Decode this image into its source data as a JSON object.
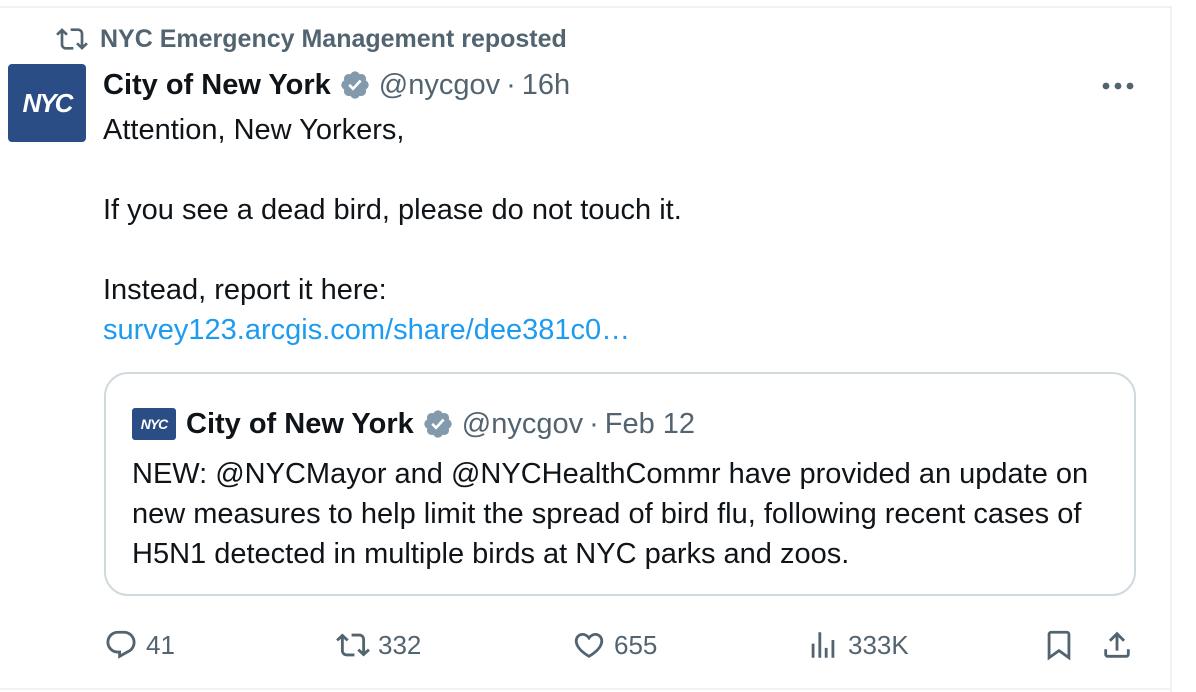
{
  "repost": {
    "label": "NYC Emergency Management reposted",
    "icon": "repost-icon"
  },
  "tweet": {
    "avatar_text": "NYC",
    "author_name": "City of New York",
    "handle": "@nycgov",
    "separator": "·",
    "time": "16h",
    "text_line1": "Attention, New Yorkers,",
    "text_line2": "If you see a dead bird, please do not touch it.",
    "text_line3": "Instead, report it here:",
    "link": "survey123.arcgis.com/share/dee381c0…"
  },
  "quote": {
    "avatar_text": "NYC",
    "author_name": "City of New York",
    "handle": "@nycgov",
    "separator": "·",
    "date": "Feb 12",
    "text": "NEW: @NYCMayor and @NYCHealthCommr have provided an update on new measures to help limit the spread of bird flu, following recent cases of H5N1 detected in multiple birds at NYC parks and zoos."
  },
  "actions": {
    "replies": "41",
    "reposts": "332",
    "likes": "655",
    "views": "333K"
  },
  "colors": {
    "link": "#1d9bf0",
    "secondary_text": "#536471",
    "verified": "#829aab",
    "avatar_bg": "#2b4d86"
  }
}
